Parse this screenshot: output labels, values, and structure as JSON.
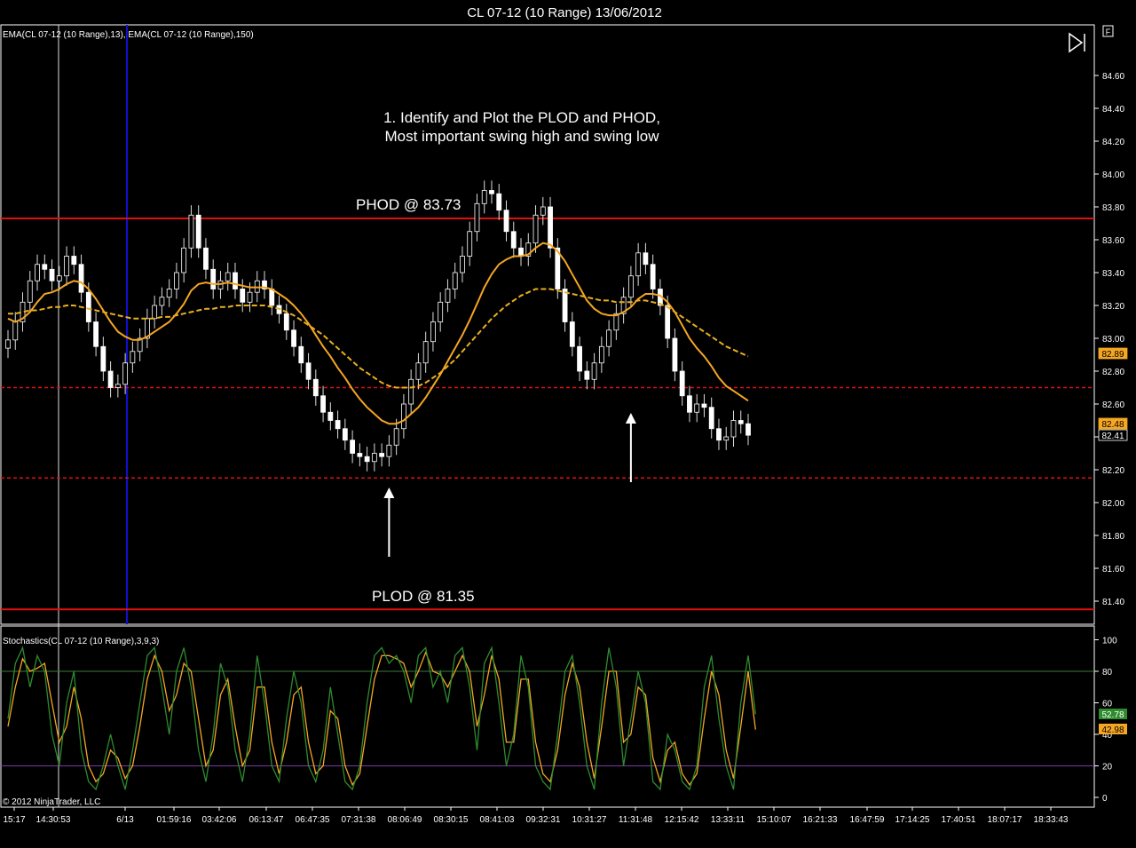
{
  "window": {
    "title": "CL 07-12 (10 Range)  13/06/2012"
  },
  "price_panel": {
    "indicator_label": "EMA(CL 07-12 (10 Range),13), EMA(CL 07-12 (10 Range),150)",
    "annotation_line1": "1. Identify and Plot the PLOD and PHOD,",
    "annotation_line2": "Most important swing high and swing low",
    "phod_label": "PHOD @ 83.73",
    "plod_label": "PLOD @ 81.35",
    "f_button": "F",
    "y_ticks": [
      "84.60",
      "84.40",
      "84.20",
      "84.00",
      "83.80",
      "83.60",
      "83.40",
      "83.20",
      "83.00",
      "82.80",
      "82.60",
      "82.40",
      "82.20",
      "82.00",
      "81.80",
      "81.60",
      "81.40"
    ],
    "badges": [
      {
        "text": "82.89",
        "color": "#f5a623",
        "text_color": "#000000"
      },
      {
        "text": "82.48",
        "color": "#f5a623",
        "text_color": "#000000"
      },
      {
        "text": "82.41",
        "color": "#000000",
        "text_color": "#ffffff"
      }
    ]
  },
  "stoch_panel": {
    "indicator_label": "Stochastics(CL 07-12 (10 Range),3,9,3)",
    "copyright": "© 2012 NinjaTrader, LLC",
    "y_ticks": [
      "100",
      "80",
      "60",
      "40",
      "20",
      "0"
    ],
    "badges": [
      {
        "text": "52.78",
        "color": "#2e8b2e",
        "text_color": "#ffffff"
      },
      {
        "text": "42.98",
        "color": "#f5a623",
        "text_color": "#000000"
      }
    ]
  },
  "x_ticks": [
    "15:17",
    "14:30:53",
    "6/13",
    "01:59:16",
    "03:42:06",
    "06:13:47",
    "06:47:35",
    "07:31:38",
    "08:06:49",
    "08:30:15",
    "08:41:03",
    "09:32:31",
    "10:31:27",
    "11:31:48",
    "12:15:42",
    "13:33:11",
    "15:10:07",
    "16:21:33",
    "16:47:59",
    "17:14:25",
    "17:40:51",
    "18:07:17",
    "18:33:43"
  ],
  "colors": {
    "background": "#000000",
    "axis": "#ffffff",
    "phod_plod": "#e01010",
    "dashed_levels": "#e01010",
    "ema_fast": "#f5a623",
    "ema_slow": "#e8b020",
    "candle_up": "#ffffff",
    "candle_down": "#ffffff",
    "stoch_k": "#2e8b2e",
    "stoch_d": "#f5a623",
    "level80": "#3a7a3a",
    "level20": "#7a3aaa",
    "session_line": "#1010d0"
  },
  "chart_data": {
    "type": "line",
    "title": "CL 07-12 (10 Range)  13/06/2012",
    "ylim": [
      81.3,
      84.7
    ],
    "levels": {
      "PHOD": 83.73,
      "PLOD": 81.35,
      "dashed_upper": 82.7,
      "dashed_lower": 82.15
    },
    "arrows": [
      {
        "bar": 52,
        "price": 82.2
      },
      {
        "bar": 85,
        "price": 82.6
      }
    ],
    "close": [
      82.99,
      83.1,
      83.22,
      83.35,
      83.45,
      83.42,
      83.35,
      83.38,
      83.5,
      83.45,
      83.28,
      83.1,
      82.95,
      82.8,
      82.7,
      82.72,
      82.85,
      82.92,
      83.0,
      83.12,
      83.2,
      83.25,
      83.3,
      83.4,
      83.55,
      83.75,
      83.55,
      83.42,
      83.3,
      83.35,
      83.4,
      83.3,
      83.22,
      83.28,
      83.35,
      83.3,
      83.2,
      83.15,
      83.05,
      82.95,
      82.85,
      82.75,
      82.65,
      82.55,
      82.5,
      82.45,
      82.38,
      82.3,
      82.28,
      82.25,
      82.3,
      82.28,
      82.35,
      82.45,
      82.6,
      82.75,
      82.85,
      82.98,
      83.1,
      83.22,
      83.3,
      83.4,
      83.5,
      83.65,
      83.82,
      83.9,
      83.88,
      83.78,
      83.65,
      83.55,
      83.5,
      83.58,
      83.75,
      83.8,
      83.55,
      83.3,
      83.1,
      82.95,
      82.8,
      82.75,
      82.85,
      82.95,
      83.05,
      83.15,
      83.25,
      83.38,
      83.52,
      83.45,
      83.3,
      83.2,
      83.0,
      82.8,
      82.65,
      82.55,
      82.6,
      82.58,
      82.45,
      82.38,
      82.4,
      82.5,
      82.48,
      82.41
    ],
    "ema13": [
      83.12,
      83.1,
      83.12,
      83.16,
      83.22,
      83.27,
      83.28,
      83.3,
      83.33,
      83.35,
      83.34,
      83.3,
      83.24,
      83.17,
      83.1,
      83.04,
      83.01,
      82.99,
      82.99,
      83.01,
      83.04,
      83.07,
      83.1,
      83.15,
      83.21,
      83.29,
      83.33,
      83.34,
      83.33,
      83.33,
      83.34,
      83.33,
      83.32,
      83.31,
      83.31,
      83.31,
      83.3,
      83.27,
      83.24,
      83.2,
      83.15,
      83.09,
      83.02,
      82.95,
      82.89,
      82.82,
      82.76,
      82.69,
      82.63,
      82.58,
      82.54,
      82.5,
      82.48,
      82.48,
      82.5,
      82.54,
      82.58,
      82.64,
      82.71,
      82.78,
      82.86,
      82.94,
      83.02,
      83.11,
      83.21,
      83.31,
      83.39,
      83.45,
      83.48,
      83.5,
      83.5,
      83.51,
      83.55,
      83.58,
      83.57,
      83.53,
      83.47,
      83.39,
      83.31,
      83.23,
      83.18,
      83.15,
      83.14,
      83.14,
      83.16,
      83.19,
      83.24,
      83.27,
      83.27,
      83.26,
      83.22,
      83.16,
      83.08,
      83.0,
      82.94,
      82.89,
      82.83,
      82.76,
      82.71,
      82.68,
      82.65,
      82.62
    ],
    "ema150": [
      83.15,
      83.15,
      83.16,
      83.17,
      83.17,
      83.18,
      83.19,
      83.19,
      83.2,
      83.2,
      83.19,
      83.18,
      83.17,
      83.16,
      83.15,
      83.14,
      83.13,
      83.12,
      83.12,
      83.12,
      83.12,
      83.13,
      83.13,
      83.14,
      83.15,
      83.16,
      83.17,
      83.18,
      83.18,
      83.19,
      83.19,
      83.2,
      83.2,
      83.2,
      83.2,
      83.2,
      83.19,
      83.18,
      83.16,
      83.14,
      83.11,
      83.08,
      83.05,
      83.02,
      82.98,
      82.94,
      82.9,
      82.86,
      82.82,
      82.79,
      82.76,
      82.73,
      82.71,
      82.7,
      82.7,
      82.7,
      82.71,
      82.73,
      82.76,
      82.79,
      82.83,
      82.87,
      82.92,
      82.97,
      83.02,
      83.07,
      83.12,
      83.16,
      83.2,
      83.23,
      83.26,
      83.28,
      83.3,
      83.3,
      83.3,
      83.29,
      83.28,
      83.27,
      83.26,
      83.25,
      83.24,
      83.23,
      83.23,
      83.22,
      83.22,
      83.22,
      83.23,
      83.23,
      83.22,
      83.21,
      83.19,
      83.16,
      83.13,
      83.1,
      83.07,
      83.04,
      83.01,
      82.98,
      82.95,
      82.93,
      82.91,
      82.89
    ],
    "stoch_k": [
      50,
      85,
      95,
      70,
      90,
      80,
      40,
      20,
      60,
      80,
      30,
      10,
      5,
      20,
      40,
      20,
      5,
      30,
      60,
      90,
      95,
      70,
      40,
      80,
      95,
      70,
      30,
      10,
      40,
      85,
      70,
      30,
      10,
      40,
      90,
      60,
      20,
      10,
      50,
      80,
      60,
      20,
      10,
      30,
      70,
      40,
      10,
      5,
      20,
      60,
      90,
      95,
      85,
      90,
      80,
      60,
      90,
      95,
      70,
      80,
      60,
      90,
      95,
      70,
      30,
      85,
      95,
      60,
      20,
      40,
      90,
      70,
      20,
      10,
      5,
      40,
      80,
      90,
      60,
      20,
      5,
      60,
      95,
      70,
      20,
      50,
      80,
      60,
      10,
      5,
      40,
      30,
      10,
      5,
      20,
      70,
      90,
      50,
      20,
      5,
      60,
      90,
      52.78
    ],
    "stoch_d": [
      45,
      70,
      88,
      80,
      82,
      85,
      60,
      35,
      45,
      70,
      50,
      20,
      10,
      15,
      30,
      25,
      12,
      20,
      45,
      75,
      90,
      80,
      55,
      65,
      85,
      80,
      50,
      20,
      30,
      65,
      75,
      45,
      20,
      30,
      70,
      70,
      35,
      15,
      35,
      65,
      70,
      35,
      15,
      20,
      55,
      50,
      20,
      8,
      15,
      45,
      75,
      90,
      90,
      88,
      85,
      70,
      80,
      92,
      80,
      78,
      70,
      80,
      90,
      80,
      45,
      65,
      90,
      75,
      35,
      35,
      75,
      75,
      35,
      15,
      10,
      30,
      65,
      85,
      70,
      35,
      12,
      45,
      80,
      80,
      35,
      40,
      70,
      65,
      25,
      10,
      30,
      35,
      15,
      8,
      15,
      50,
      80,
      65,
      30,
      12,
      45,
      80,
      42.98
    ]
  }
}
